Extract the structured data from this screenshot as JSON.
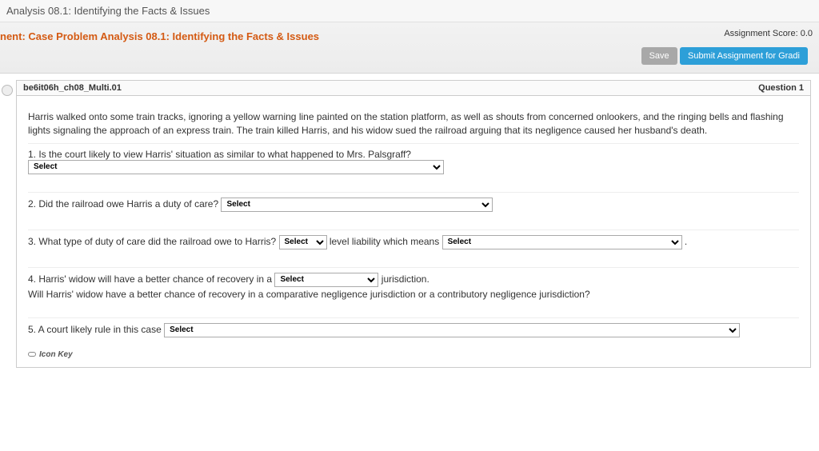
{
  "top_strip": {
    "title": "Analysis 08.1: Identifying the Facts & Issues"
  },
  "assignment": {
    "title_prefix": "nent: Case Problem Analysis 08.1: Identifying the Facts & Issues",
    "score_label": "Assignment Score: 0.0",
    "save_label": "Save",
    "submit_label": "Submit Assignment for Gradi"
  },
  "question_header": {
    "code": "be6it06h_ch08_Multi.01",
    "qnum": "Question 1"
  },
  "scenario": "Harris walked onto some train tracks, ignoring a yellow warning line painted on the station platform, as well as shouts from concerned onlookers, and the ringing bells and flashing lights signaling the approach of an express train. The train killed Harris, and his widow sued the railroad arguing that its negligence caused her husband's death.",
  "q1": {
    "text": "1. Is the court likely to view Harris' situation as similar to what happened to Mrs. Palsgraff?",
    "select_placeholder": "Select"
  },
  "q2": {
    "text": "2. Did the railroad owe Harris a duty of care?",
    "select_placeholder": "Select"
  },
  "q3": {
    "text_a": "3. What type of duty of care did the railroad owe to Harris?",
    "select1_placeholder": "Select",
    "text_b": "level liability which means",
    "select2_placeholder": "Select",
    "trail": "."
  },
  "q4": {
    "text_a": "4. Harris' widow will have a better chance of recovery in a",
    "select_placeholder": "Select",
    "text_b": "jurisdiction.",
    "subtext": "Will Harris' widow have a better chance of recovery in a comparative negligence jurisdiction or a contributory negligence jurisdiction?"
  },
  "q5": {
    "text": "5. A court likely rule in this case",
    "select_placeholder": "Select"
  },
  "icon_key_label": "Icon Key"
}
